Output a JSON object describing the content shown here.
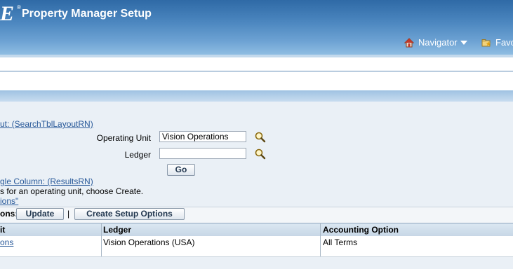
{
  "header": {
    "logo_letter": "E",
    "logo_mark": "®",
    "app_title": "Property Manager Setup",
    "navigator_label": "Navigator",
    "favorites_label": "Favo"
  },
  "search": {
    "region_link": "ut: (SearchTblLayoutRN)",
    "operating_unit_label": "Operating Unit",
    "operating_unit_value": "Vision Operations",
    "ledger_label": "Ledger",
    "ledger_value": "",
    "go_button": "Go"
  },
  "results": {
    "region_link": "gle Column: (ResultsRN)",
    "instruction": "s for an operating unit, choose Create.",
    "quote_link": "ions\""
  },
  "actions": {
    "label": "ons:",
    "update_button": "Update",
    "separator": "|",
    "create_button": "Create Setup Options"
  },
  "table": {
    "columns": [
      "it",
      "Ledger",
      "Accounting Option"
    ],
    "rows": [
      [
        "ons",
        "Vision Operations (USA)",
        "All Terms"
      ]
    ]
  },
  "colors": {
    "header_blue": "#2f6aa6",
    "link": "#2a5a9a",
    "panel_bg": "#eaf0f6"
  }
}
